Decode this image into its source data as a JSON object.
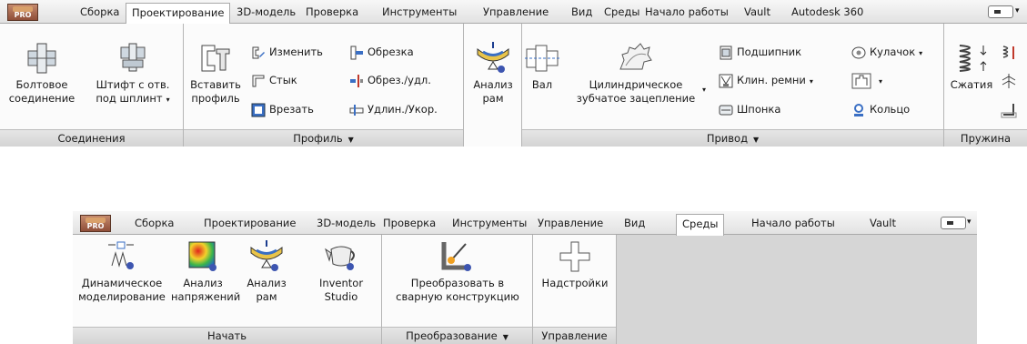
{
  "top_ribbon": {
    "pro_badge": "PRO",
    "tabs": [
      {
        "label": "Сборка"
      },
      {
        "label": "Проектирование"
      },
      {
        "label": "3D-модель"
      },
      {
        "label": "Проверка"
      },
      {
        "label": "Инструменты"
      },
      {
        "label": "Управление"
      },
      {
        "label": "Вид"
      },
      {
        "label": "Среды"
      },
      {
        "label": "Начало работы"
      },
      {
        "label": "Vault"
      },
      {
        "label": "Autodesk 360"
      }
    ],
    "active_tab": "Проектирование",
    "panels": {
      "connections": {
        "title": "Соединения",
        "bolted_line1": "Болтовое",
        "bolted_line2": "соединение",
        "pin_line1": "Штифт с отв.",
        "pin_line2": "под шплинт"
      },
      "profile": {
        "title": "Профиль",
        "insert_line1": "Вставить",
        "insert_line2": "профиль",
        "change": "Изменить",
        "joint": "Стык",
        "notch": "Врезать",
        "trim": "Обрезка",
        "trim_delete": "Обрез./удл.",
        "lengthen_shorten": "Удлин./Укор."
      },
      "frame_analysis": {
        "line1": "Анализ",
        "line2": "рам"
      },
      "drive": {
        "title": "Привод",
        "shaft": "Вал",
        "spur_gear_line1": "Цилиндрическое",
        "spur_gear_line2": "зубчатое зацепление",
        "bearing": "Подшипник",
        "v_belt": "Клин. ремни",
        "key": "Шпонка",
        "cam": "Кулачок",
        "ring": "Кольцо"
      },
      "spring": {
        "title": "Пружина",
        "compression": "Сжатия"
      }
    }
  },
  "bottom_ribbon": {
    "pro_badge": "PRO",
    "tabs": [
      {
        "label": "Сборка"
      },
      {
        "label": "Проектирование"
      },
      {
        "label": "3D-модель"
      },
      {
        "label": "Проверка"
      },
      {
        "label": "Инструменты"
      },
      {
        "label": "Управление"
      },
      {
        "label": "Вид"
      },
      {
        "label": "Среды"
      },
      {
        "label": "Начало работы"
      },
      {
        "label": "Vault"
      }
    ],
    "active_tab": "Среды",
    "panels": {
      "begin": {
        "title": "Начать",
        "dynamic_line1": "Динамическое",
        "dynamic_line2": "моделирование",
        "stress_line1": "Анализ",
        "stress_line2": "напряжений",
        "frame_line1": "Анализ",
        "frame_line2": "рам",
        "studio_line1": "Inventor",
        "studio_line2": "Studio"
      },
      "convert": {
        "title": "Преобразование",
        "weld_line1": "Преобразовать в",
        "weld_line2": "сварную конструкцию"
      },
      "manage": {
        "title": "Управление",
        "addins": "Надстройки"
      }
    }
  }
}
